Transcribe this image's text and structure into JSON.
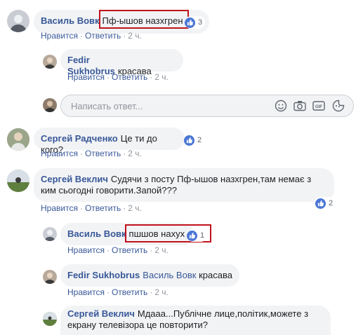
{
  "actions": {
    "like": "Нравится",
    "reply": "Ответить",
    "separator": "·",
    "time": "2 ч."
  },
  "comments": [
    {
      "author": "Василь Вовк",
      "text": "Пф-ышов назхгрен",
      "reactions": "3"
    },
    {
      "author": "Fedir Sukhobrus",
      "text": "красава"
    },
    {
      "author": "Сергей Радченко",
      "text": "Це ти до кого?",
      "reactions": "2"
    },
    {
      "author": "Сергей Веклич",
      "text_line1": "Судячи з посту Пф-ышов назхгрен,там немає з",
      "text_line2": "ким сьогодні говорити.Запой???",
      "reactions": "2"
    },
    {
      "author": "Василь Вовк",
      "text": "пшшов нахух",
      "reactions": "1"
    },
    {
      "author": "Fedir Sukhobrus",
      "mention": "Василь Вовк",
      "text": "красава"
    },
    {
      "author": "Сергей Веклич",
      "text_line1": "Мдааа...Публічне лице,політик,можете з",
      "text_line2": "екрану телевізора це повторити?"
    }
  ],
  "reply_box": {
    "placeholder": "Написать ответ..."
  },
  "colors": {
    "link": "#385898",
    "highlight": "#c0131b",
    "like": "#4a76d6",
    "bubble": "#f2f3f5"
  }
}
